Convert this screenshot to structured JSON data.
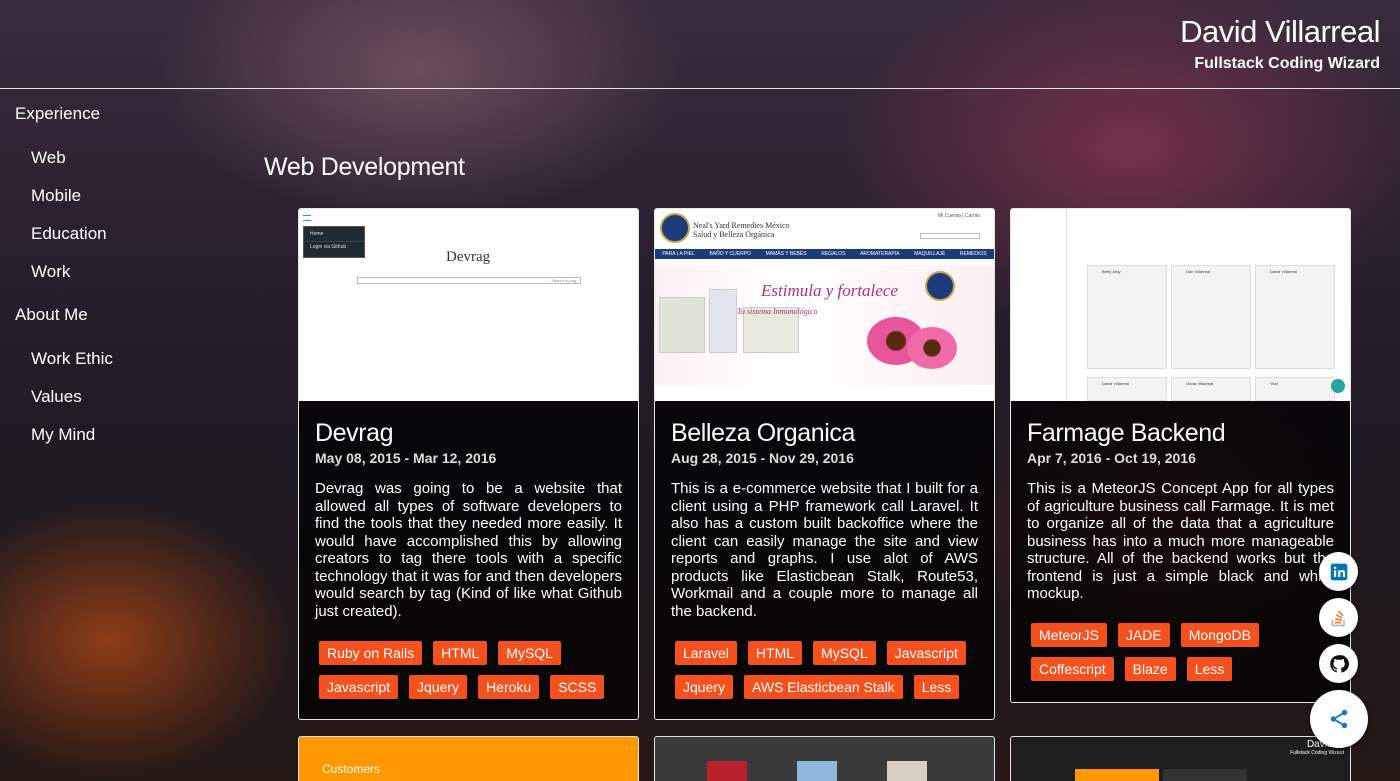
{
  "header": {
    "name": "David Villarreal",
    "subtitle": "Fullstack Coding Wizard"
  },
  "sidebar": {
    "groups": [
      {
        "label": "Experience",
        "items": [
          "Web",
          "Mobile",
          "Education",
          "Work"
        ]
      },
      {
        "label": "About Me",
        "items": [
          "Work Ethic",
          "Values",
          "My Mind"
        ]
      }
    ]
  },
  "section": {
    "title": "Web Development"
  },
  "cards": [
    {
      "title": "Devrag",
      "dates": "May 08, 2015 - Mar 12, 2016",
      "description": "Devrag was going to be a website that allowed all types of software developers to find the tools that they needed more easily. It would have accomplished this by allowing creators to tag there tools with a specific technology that it was for and then developers would search by tag (Kind of like what Github just created).",
      "tags": [
        "Ruby on Rails",
        "HTML",
        "MySQL",
        "Javascript",
        "Jquery",
        "Heroku",
        "SCSS"
      ],
      "preview": {
        "heading": "Devrag",
        "menu_items": [
          "Home",
          "Login via Github"
        ],
        "search_placeholder": "Search by tag"
      }
    },
    {
      "title": "Belleza Organica",
      "dates": "Aug 28, 2015 - Nov 29, 2016",
      "description": "This is a e-commerce website that I built for a client using a PHP framework call Laravel. It also has a custom built backoffice where the client can easily manage the site and view reports and graphs. I use alot of AWS products like Elasticbean Stalk, Route53, Workmail and a couple more to manage all the backend.",
      "tags": [
        "Laravel",
        "HTML",
        "MySQL",
        "Javascript",
        "Jquery",
        "AWS Elasticbean Stalk",
        "Less"
      ],
      "preview": {
        "store_name": "Neal's Yard Remedies México",
        "store_sub": "Salud y Belleza Orgánica",
        "account": "Mi Cuenta | Carrito",
        "nav": [
          "PARA LA PIEL",
          "BAÑO Y CUERPO",
          "MAMÁS Y BEBÉS",
          "REGALOS",
          "AROMATERAPIA",
          "MAQUILLAJE",
          "REMEDIOS"
        ],
        "banner_title": "Estimula y fortalece",
        "banner_sub": "Tu sistema Inmunológico"
      }
    },
    {
      "title": "Farmage Backend",
      "dates": "Apr 7, 2016 - Oct 19, 2016",
      "description": "This is a MeteorJS Concept App for all types of agriculture business call Farmage. It is met to organize all of the data that a agriculture business has into a much more manageable structure. All of the backend works but the frontend is just a simple black and white mockup.",
      "tags": [
        "MeteorJS",
        "JADE",
        "MongoDB",
        "Coffescript",
        "Blaze",
        "Less"
      ],
      "preview": {
        "contacts": [
          "Betty Jeby",
          "Dan Villarreal",
          "David Villarreal",
          "David Villarreal",
          "Oscar Villarreal",
          "Yital"
        ]
      }
    }
  ],
  "bottom_previews": [
    {
      "label": "Customers",
      "color": "#ff9800"
    },
    {
      "label": "",
      "color": "#3a3a3a"
    },
    {
      "label": "David Vi",
      "sub": "Fullstack Coding Wizard",
      "color": "#1e1e1e"
    }
  ],
  "social": {
    "buttons": [
      "linkedin-icon",
      "stackoverflow-icon",
      "github-icon",
      "share-icon"
    ],
    "accent": "#1976d2"
  },
  "colors": {
    "tag": "#f4511e",
    "card_bg": "rgba(0,0,0,0.72)"
  }
}
